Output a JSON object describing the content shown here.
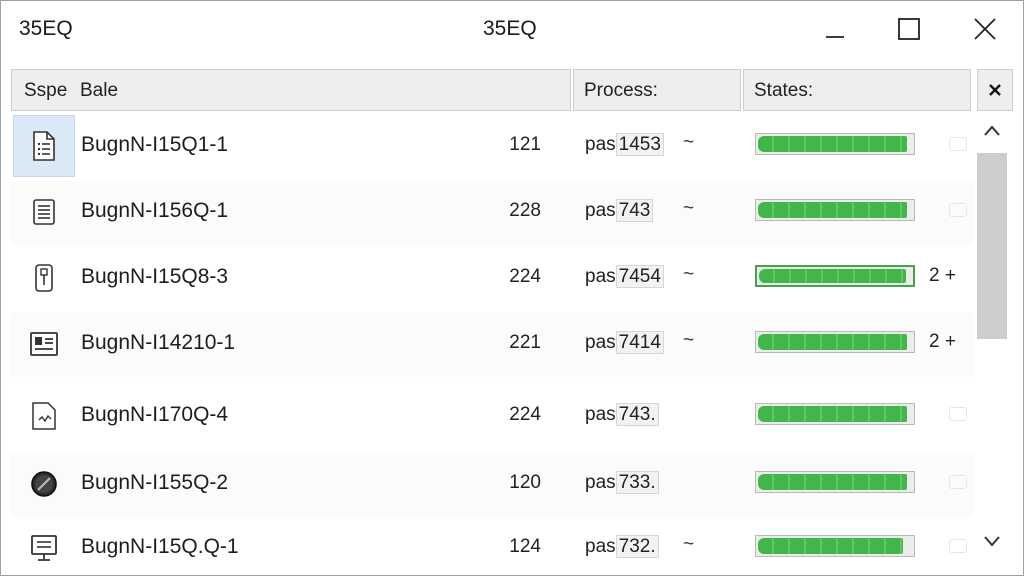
{
  "window": {
    "title": "35EQ",
    "center_title": "35EQ"
  },
  "header": {
    "type_label": "Sspe",
    "name_label": "Bale",
    "process_label": "Process:",
    "states_label": "States:"
  },
  "rows": [
    {
      "icon": "document-list-icon",
      "name": "BugnN-I15Q1-1",
      "num": "121",
      "proc_prefix": "pas",
      "proc_box": "1453",
      "tilde": "~",
      "progress": 0.97,
      "extra": ""
    },
    {
      "icon": "document-lines-icon",
      "name": "BugnN-I156Q-1",
      "num": "228",
      "proc_prefix": "pas",
      "proc_box": "743",
      "tilde": "~",
      "progress": 0.97,
      "extra": ""
    },
    {
      "icon": "usb-drive-icon",
      "name": "BugnN-I15Q8-3",
      "num": "224",
      "proc_prefix": "pas",
      "proc_box": "7454",
      "tilde": "~",
      "progress": 0.97,
      "extra": "2 +"
    },
    {
      "icon": "monitor-app-icon",
      "name": "BugnN-I14210-1",
      "num": "221",
      "proc_prefix": "pas",
      "proc_box": "7414",
      "tilde": "~",
      "progress": 0.97,
      "extra": "2 +"
    },
    {
      "icon": "code-file-icon",
      "name": "BugnN-I170Q-4",
      "num": "224",
      "proc_prefix": "pas",
      "proc_box": "743.",
      "tilde": "",
      "progress": 0.97,
      "extra": ""
    },
    {
      "icon": "disc-icon",
      "name": "BugnN-I155Q-2",
      "num": "120",
      "proc_prefix": "pas",
      "proc_box": "733.",
      "tilde": "",
      "progress": 0.97,
      "extra": ""
    },
    {
      "icon": "computer-icon",
      "name": "BugnN-I15Q.Q-1",
      "num": "124",
      "proc_prefix": "pas",
      "proc_box": "732.",
      "tilde": "~",
      "progress": 0.94,
      "extra": ""
    }
  ]
}
